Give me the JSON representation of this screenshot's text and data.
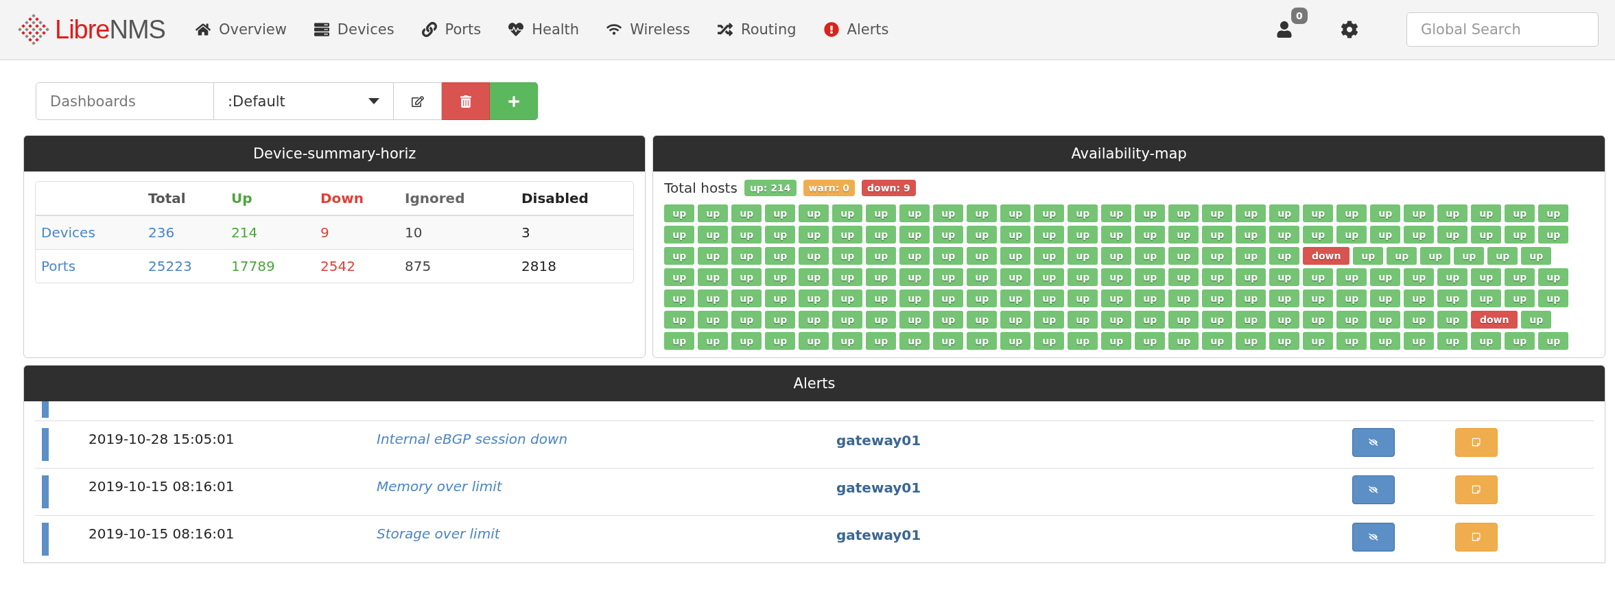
{
  "navbar": {
    "logo": {
      "first": "Libre",
      "second": "NMS"
    },
    "items": [
      {
        "label": "Overview",
        "kind": "home"
      },
      {
        "label": "Devices",
        "kind": "server"
      },
      {
        "label": "Ports",
        "kind": "link"
      },
      {
        "label": "Health",
        "kind": "heartbeat"
      },
      {
        "label": "Wireless",
        "kind": "wifi"
      },
      {
        "label": "Routing",
        "kind": "random"
      },
      {
        "label": "Alerts",
        "kind": "alert"
      }
    ],
    "notification_count": "0",
    "search": {
      "placeholder": "Global Search"
    }
  },
  "dashboard_bar": {
    "label": "Dashboards",
    "selected_dashboard": ":Default"
  },
  "device_summary": {
    "title": "Device-summary-horiz",
    "columns": [
      {
        "label": "Total",
        "kind": "total"
      },
      {
        "label": "Up",
        "kind": "up"
      },
      {
        "label": "Down",
        "kind": "down"
      },
      {
        "label": "Ignored",
        "kind": "ignored"
      },
      {
        "label": "Disabled",
        "kind": "disabled"
      }
    ],
    "rows": [
      {
        "label": "Devices",
        "values": [
          "236",
          "214",
          "9",
          "10",
          "3"
        ]
      },
      {
        "label": "Ports",
        "values": [
          "25223",
          "17789",
          "2542",
          "875",
          "2818"
        ]
      }
    ]
  },
  "availability_map": {
    "title": "Availability-map",
    "total_label": "Total hosts",
    "counts": [
      {
        "label": "up: 214",
        "kind": "up"
      },
      {
        "label": "warn: 0",
        "kind": "warn"
      },
      {
        "label": "down: 9",
        "kind": "down"
      }
    ],
    "tile_rows": [
      [
        {
          "label": "up",
          "kind": "up"
        },
        {
          "label": "up",
          "kind": "up"
        },
        {
          "label": "up",
          "kind": "up"
        },
        {
          "label": "up",
          "kind": "up"
        },
        {
          "label": "up",
          "kind": "up"
        },
        {
          "label": "up",
          "kind": "up"
        },
        {
          "label": "up",
          "kind": "up"
        },
        {
          "label": "up",
          "kind": "up"
        },
        {
          "label": "up",
          "kind": "up"
        },
        {
          "label": "up",
          "kind": "up"
        },
        {
          "label": "up",
          "kind": "up"
        },
        {
          "label": "up",
          "kind": "up"
        },
        {
          "label": "up",
          "kind": "up"
        },
        {
          "label": "up",
          "kind": "up"
        },
        {
          "label": "up",
          "kind": "up"
        },
        {
          "label": "up",
          "kind": "up"
        },
        {
          "label": "up",
          "kind": "up"
        },
        {
          "label": "up",
          "kind": "up"
        },
        {
          "label": "up",
          "kind": "up"
        },
        {
          "label": "up",
          "kind": "up"
        },
        {
          "label": "up",
          "kind": "up"
        },
        {
          "label": "up",
          "kind": "up"
        },
        {
          "label": "up",
          "kind": "up"
        },
        {
          "label": "up",
          "kind": "up"
        },
        {
          "label": "up",
          "kind": "up"
        },
        {
          "label": "up",
          "kind": "up"
        },
        {
          "label": "up",
          "kind": "up"
        }
      ],
      [
        {
          "label": "up",
          "kind": "up"
        },
        {
          "label": "up",
          "kind": "up"
        },
        {
          "label": "up",
          "kind": "up"
        },
        {
          "label": "up",
          "kind": "up"
        },
        {
          "label": "up",
          "kind": "up"
        },
        {
          "label": "up",
          "kind": "up"
        },
        {
          "label": "up",
          "kind": "up"
        },
        {
          "label": "up",
          "kind": "up"
        },
        {
          "label": "up",
          "kind": "up"
        },
        {
          "label": "up",
          "kind": "up"
        },
        {
          "label": "up",
          "kind": "up"
        },
        {
          "label": "up",
          "kind": "up"
        },
        {
          "label": "up",
          "kind": "up"
        },
        {
          "label": "up",
          "kind": "up"
        },
        {
          "label": "up",
          "kind": "up"
        },
        {
          "label": "up",
          "kind": "up"
        },
        {
          "label": "up",
          "kind": "up"
        },
        {
          "label": "up",
          "kind": "up"
        },
        {
          "label": "up",
          "kind": "up"
        },
        {
          "label": "up",
          "kind": "up"
        },
        {
          "label": "up",
          "kind": "up"
        },
        {
          "label": "up",
          "kind": "up"
        },
        {
          "label": "up",
          "kind": "up"
        },
        {
          "label": "up",
          "kind": "up"
        },
        {
          "label": "up",
          "kind": "up"
        },
        {
          "label": "up",
          "kind": "up"
        },
        {
          "label": "up",
          "kind": "up"
        }
      ],
      [
        {
          "label": "up",
          "kind": "up"
        },
        {
          "label": "up",
          "kind": "up"
        },
        {
          "label": "up",
          "kind": "up"
        },
        {
          "label": "up",
          "kind": "up"
        },
        {
          "label": "up",
          "kind": "up"
        },
        {
          "label": "up",
          "kind": "up"
        },
        {
          "label": "up",
          "kind": "up"
        },
        {
          "label": "up",
          "kind": "up"
        },
        {
          "label": "up",
          "kind": "up"
        },
        {
          "label": "up",
          "kind": "up"
        },
        {
          "label": "up",
          "kind": "up"
        },
        {
          "label": "up",
          "kind": "up"
        },
        {
          "label": "up",
          "kind": "up"
        },
        {
          "label": "up",
          "kind": "up"
        },
        {
          "label": "up",
          "kind": "up"
        },
        {
          "label": "up",
          "kind": "up"
        },
        {
          "label": "up",
          "kind": "up"
        },
        {
          "label": "up",
          "kind": "up"
        },
        {
          "label": "up",
          "kind": "up"
        },
        {
          "label": "down",
          "kind": "down"
        },
        {
          "label": "up",
          "kind": "up"
        },
        {
          "label": "up",
          "kind": "up"
        },
        {
          "label": "up",
          "kind": "up"
        },
        {
          "label": "up",
          "kind": "up"
        },
        {
          "label": "up",
          "kind": "up"
        },
        {
          "label": "up",
          "kind": "up"
        }
      ],
      [
        {
          "label": "up",
          "kind": "up"
        },
        {
          "label": "up",
          "kind": "up"
        },
        {
          "label": "up",
          "kind": "up"
        },
        {
          "label": "up",
          "kind": "up"
        },
        {
          "label": "up",
          "kind": "up"
        },
        {
          "label": "up",
          "kind": "up"
        },
        {
          "label": "up",
          "kind": "up"
        },
        {
          "label": "up",
          "kind": "up"
        },
        {
          "label": "up",
          "kind": "up"
        },
        {
          "label": "up",
          "kind": "up"
        },
        {
          "label": "up",
          "kind": "up"
        },
        {
          "label": "up",
          "kind": "up"
        },
        {
          "label": "up",
          "kind": "up"
        },
        {
          "label": "up",
          "kind": "up"
        },
        {
          "label": "up",
          "kind": "up"
        },
        {
          "label": "up",
          "kind": "up"
        },
        {
          "label": "up",
          "kind": "up"
        },
        {
          "label": "up",
          "kind": "up"
        },
        {
          "label": "up",
          "kind": "up"
        },
        {
          "label": "up",
          "kind": "up"
        },
        {
          "label": "up",
          "kind": "up"
        },
        {
          "label": "up",
          "kind": "up"
        },
        {
          "label": "up",
          "kind": "up"
        },
        {
          "label": "up",
          "kind": "up"
        },
        {
          "label": "up",
          "kind": "up"
        },
        {
          "label": "up",
          "kind": "up"
        },
        {
          "label": "up",
          "kind": "up"
        }
      ],
      [
        {
          "label": "up",
          "kind": "up"
        },
        {
          "label": "up",
          "kind": "up"
        },
        {
          "label": "up",
          "kind": "up"
        },
        {
          "label": "up",
          "kind": "up"
        },
        {
          "label": "up",
          "kind": "up"
        },
        {
          "label": "up",
          "kind": "up"
        },
        {
          "label": "up",
          "kind": "up"
        },
        {
          "label": "up",
          "kind": "up"
        },
        {
          "label": "up",
          "kind": "up"
        },
        {
          "label": "up",
          "kind": "up"
        },
        {
          "label": "up",
          "kind": "up"
        },
        {
          "label": "up",
          "kind": "up"
        },
        {
          "label": "up",
          "kind": "up"
        },
        {
          "label": "up",
          "kind": "up"
        },
        {
          "label": "up",
          "kind": "up"
        },
        {
          "label": "up",
          "kind": "up"
        },
        {
          "label": "up",
          "kind": "up"
        },
        {
          "label": "up",
          "kind": "up"
        },
        {
          "label": "up",
          "kind": "up"
        },
        {
          "label": "up",
          "kind": "up"
        },
        {
          "label": "up",
          "kind": "up"
        },
        {
          "label": "up",
          "kind": "up"
        },
        {
          "label": "up",
          "kind": "up"
        },
        {
          "label": "up",
          "kind": "up"
        },
        {
          "label": "up",
          "kind": "up"
        },
        {
          "label": "up",
          "kind": "up"
        },
        {
          "label": "up",
          "kind": "up"
        }
      ],
      [
        {
          "label": "up",
          "kind": "up"
        },
        {
          "label": "up",
          "kind": "up"
        },
        {
          "label": "up",
          "kind": "up"
        },
        {
          "label": "up",
          "kind": "up"
        },
        {
          "label": "up",
          "kind": "up"
        },
        {
          "label": "up",
          "kind": "up"
        },
        {
          "label": "up",
          "kind": "up"
        },
        {
          "label": "up",
          "kind": "up"
        },
        {
          "label": "up",
          "kind": "up"
        },
        {
          "label": "up",
          "kind": "up"
        },
        {
          "label": "up",
          "kind": "up"
        },
        {
          "label": "up",
          "kind": "up"
        },
        {
          "label": "up",
          "kind": "up"
        },
        {
          "label": "up",
          "kind": "up"
        },
        {
          "label": "up",
          "kind": "up"
        },
        {
          "label": "up",
          "kind": "up"
        },
        {
          "label": "up",
          "kind": "up"
        },
        {
          "label": "up",
          "kind": "up"
        },
        {
          "label": "up",
          "kind": "up"
        },
        {
          "label": "up",
          "kind": "up"
        },
        {
          "label": "up",
          "kind": "up"
        },
        {
          "label": "up",
          "kind": "up"
        },
        {
          "label": "up",
          "kind": "up"
        },
        {
          "label": "up",
          "kind": "up"
        },
        {
          "label": "down",
          "kind": "down"
        },
        {
          "label": "up",
          "kind": "up"
        }
      ],
      [
        {
          "label": "up",
          "kind": "up"
        },
        {
          "label": "up",
          "kind": "up"
        },
        {
          "label": "up",
          "kind": "up"
        },
        {
          "label": "up",
          "kind": "up"
        },
        {
          "label": "up",
          "kind": "up"
        },
        {
          "label": "up",
          "kind": "up"
        },
        {
          "label": "up",
          "kind": "up"
        },
        {
          "label": "up",
          "kind": "up"
        },
        {
          "label": "up",
          "kind": "up"
        },
        {
          "label": "up",
          "kind": "up"
        },
        {
          "label": "up",
          "kind": "up"
        },
        {
          "label": "up",
          "kind": "up"
        },
        {
          "label": "up",
          "kind": "up"
        },
        {
          "label": "up",
          "kind": "up"
        },
        {
          "label": "up",
          "kind": "up"
        },
        {
          "label": "up",
          "kind": "up"
        },
        {
          "label": "up",
          "kind": "up"
        },
        {
          "label": "up",
          "kind": "up"
        },
        {
          "label": "up",
          "kind": "up"
        },
        {
          "label": "up",
          "kind": "up"
        },
        {
          "label": "up",
          "kind": "up"
        },
        {
          "label": "up",
          "kind": "up"
        },
        {
          "label": "up",
          "kind": "up"
        },
        {
          "label": "up",
          "kind": "up"
        },
        {
          "label": "up",
          "kind": "up"
        },
        {
          "label": "up",
          "kind": "up"
        },
        {
          "label": "up",
          "kind": "up"
        }
      ]
    ]
  },
  "alerts": {
    "title": "Alerts",
    "rows": [
      {
        "time": "2019-10-28 15:05:01",
        "rule": "Internal eBGP session down",
        "host": "gateway01"
      },
      {
        "time": "2019-10-15 08:16:01",
        "rule": "Memory over limit",
        "host": "gateway01"
      },
      {
        "time": "2019-10-15 08:16:01",
        "rule": "Storage over limit",
        "host": "gateway01"
      }
    ]
  }
}
